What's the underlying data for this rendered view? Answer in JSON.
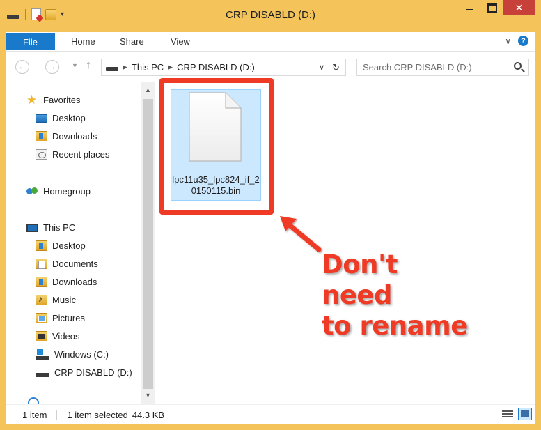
{
  "window": {
    "title": "CRP DISABLD (D:)",
    "close_symbol": "✕",
    "frame_color": "#f4c35a"
  },
  "ribbon": {
    "tabs": [
      {
        "label": "File"
      },
      {
        "label": "Home"
      },
      {
        "label": "Share"
      },
      {
        "label": "View"
      }
    ],
    "help_symbol": "?",
    "accent": "#1979ca"
  },
  "address_bar": {
    "crumbs": [
      "This PC",
      "CRP DISABLD (D:)"
    ],
    "search_placeholder": "Search CRP DISABLD (D:)"
  },
  "nav_pane": {
    "favorites": {
      "label": "Favorites",
      "items": [
        {
          "label": "Desktop",
          "icon": "desktop-icon"
        },
        {
          "label": "Downloads",
          "icon": "downloads-folder-icon"
        },
        {
          "label": "Recent places",
          "icon": "recent-places-icon"
        }
      ]
    },
    "homegroup": {
      "label": "Homegroup"
    },
    "this_pc": {
      "label": "This PC",
      "items": [
        {
          "label": "Desktop",
          "icon": "desktop-folder-icon"
        },
        {
          "label": "Documents",
          "icon": "documents-folder-icon"
        },
        {
          "label": "Downloads",
          "icon": "downloads-folder-icon"
        },
        {
          "label": "Music",
          "icon": "music-folder-icon"
        },
        {
          "label": "Pictures",
          "icon": "pictures-folder-icon"
        },
        {
          "label": "Videos",
          "icon": "videos-folder-icon"
        },
        {
          "label": "Windows (C:)",
          "icon": "windows-drive-icon"
        },
        {
          "label": "CRP DISABLD (D:)",
          "icon": "usb-drive-icon",
          "selected": true
        }
      ]
    }
  },
  "content": {
    "files": [
      {
        "name": "lpc11u35_lpc824_if_20150115.bin",
        "selected": true
      }
    ]
  },
  "annotation": {
    "line1": "Don't need",
    "line2": "to rename",
    "color": "#ef3b25"
  },
  "status_bar": {
    "count": "1 item",
    "selection": "1 item selected",
    "size": "44.3 KB"
  }
}
